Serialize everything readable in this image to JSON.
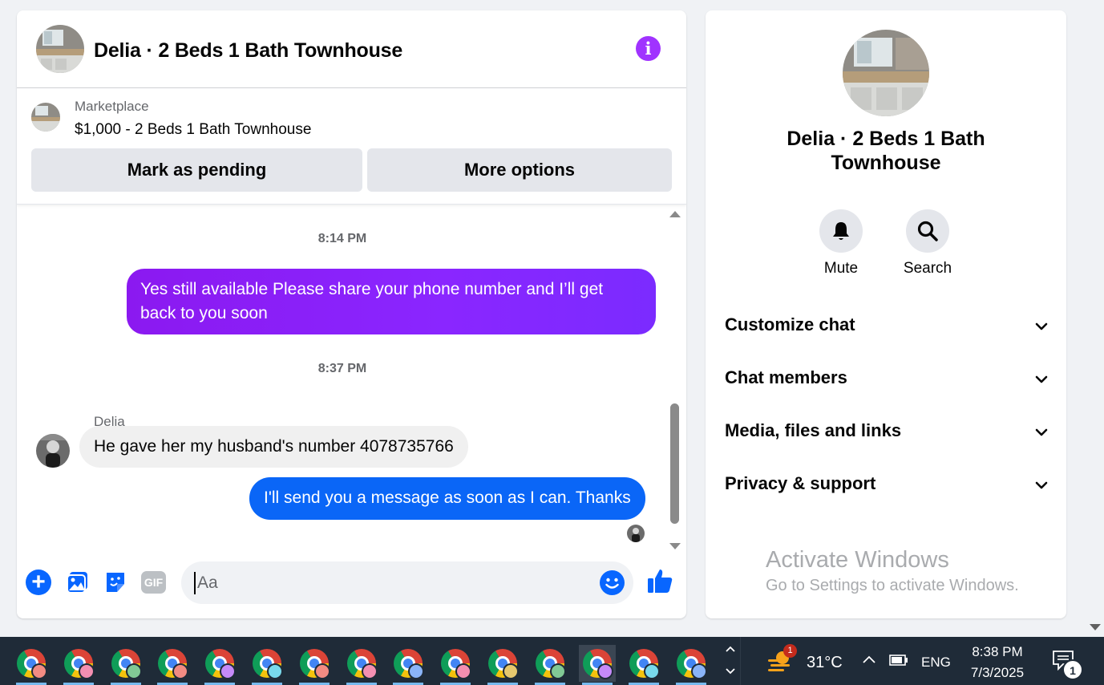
{
  "chat": {
    "title": "Delia · 2 Beds 1 Bath Townhouse",
    "listing": {
      "source": "Marketplace",
      "name": "$1,000 - 2 Beds 1 Bath Townhouse",
      "pending_label": "Mark as pending",
      "more_label": "More options"
    },
    "messages": {
      "time_1": "8:14 PM",
      "out_1": "Yes still available Please share your phone number and I’ll get back to you soon",
      "time_2": "8:37 PM",
      "sender": "Delia",
      "in_1": "He gave her my husband's number 4078735766",
      "out_2": "I'll send you a message as soon as I can. Thanks"
    },
    "composer": {
      "placeholder": "Aa",
      "gif_label": "GIF",
      "icons": [
        "plus-icon",
        "photo-icon",
        "sticker-icon",
        "gif-icon",
        "emoji-icon",
        "like-icon"
      ]
    },
    "colors": {
      "outgoing_purple": "#8a26ff",
      "outgoing_blue": "#0a66f7",
      "accent": "#0866ff",
      "info": "#a033ff"
    }
  },
  "side": {
    "title": "Delia · 2 Beds 1 Bath Townhouse",
    "actions": [
      {
        "label": "Mute",
        "icon": "bell-icon"
      },
      {
        "label": "Search",
        "icon": "search-icon"
      }
    ],
    "sections": [
      {
        "label": "Customize chat"
      },
      {
        "label": "Chat members"
      },
      {
        "label": "Media, files and links"
      },
      {
        "label": "Privacy & support"
      }
    ]
  },
  "watermark": {
    "title": "Activate Windows",
    "subtitle": "Go to Settings to activate Windows."
  },
  "taskbar": {
    "apps": [
      {
        "icon": "chrome-icon",
        "profile_color": "#f28b82"
      },
      {
        "icon": "chrome-icon",
        "profile_color": "#f48fb1"
      },
      {
        "icon": "chrome-icon",
        "profile_color": "#81c995"
      },
      {
        "icon": "chrome-icon",
        "profile_color": "#f28b82"
      },
      {
        "icon": "chrome-icon",
        "profile_color": "#c58af9"
      },
      {
        "icon": "chrome-icon",
        "profile_color": "#78d9ec"
      },
      {
        "icon": "chrome-icon",
        "profile_color": "#f28b82"
      },
      {
        "icon": "chrome-icon",
        "profile_color": "#f48fb1"
      },
      {
        "icon": "chrome-icon",
        "profile_color": "#8ab4f8"
      },
      {
        "icon": "chrome-icon",
        "profile_color": "#f48fb1"
      },
      {
        "icon": "chrome-icon",
        "profile_color": "#e6c86e"
      },
      {
        "icon": "chrome-icon",
        "profile_color": "#81c995"
      },
      {
        "icon": "chrome-icon",
        "profile_color": "#c58af9"
      },
      {
        "icon": "chrome-icon",
        "profile_color": "#78d9ec"
      },
      {
        "icon": "chrome-icon",
        "profile_color": "#8ab4f8"
      }
    ],
    "weather_badge": "1",
    "temperature": "31°C",
    "language": "ENG",
    "time": "8:38 PM",
    "date": "7/3/2025",
    "notification_count": "1"
  }
}
